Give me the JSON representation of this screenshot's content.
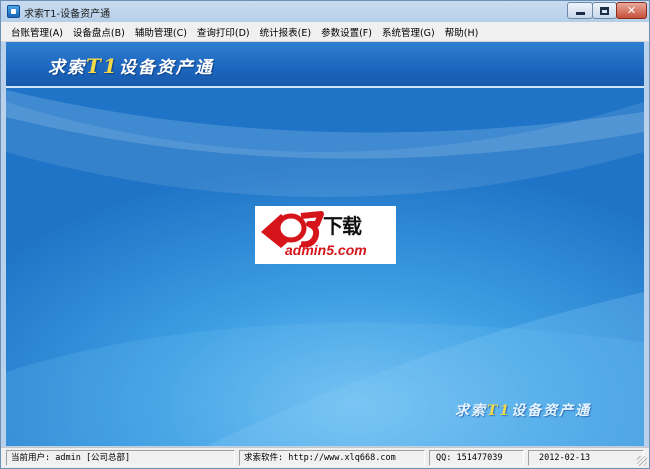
{
  "window": {
    "title": "求索T1-设备资产通"
  },
  "menu": {
    "items": [
      "台账管理(A)",
      "设备盘点(B)",
      "辅助管理(C)",
      "查询打印(D)",
      "统计报表(E)",
      "参数设置(F)",
      "系统管理(G)",
      "帮助(H)"
    ]
  },
  "banner": {
    "title_prefix": "求索",
    "title_t1": "T1",
    "title_suffix": "设备资产通"
  },
  "logo": {
    "cn_text": "下载",
    "domain": "admin5.com"
  },
  "watermark": {
    "prefix": "求索",
    "t1": "T1",
    "suffix": "设备资产通"
  },
  "status": {
    "user": "当前用户: admin [公司总部]",
    "software": "求索软件: http://www.xlq668.com",
    "qq": "QQ: 151477039",
    "date": "2012-02-13"
  },
  "colors": {
    "accent": "#1d66bf",
    "title_gold": "#f4d94a",
    "logo_red": "#d6151b"
  }
}
